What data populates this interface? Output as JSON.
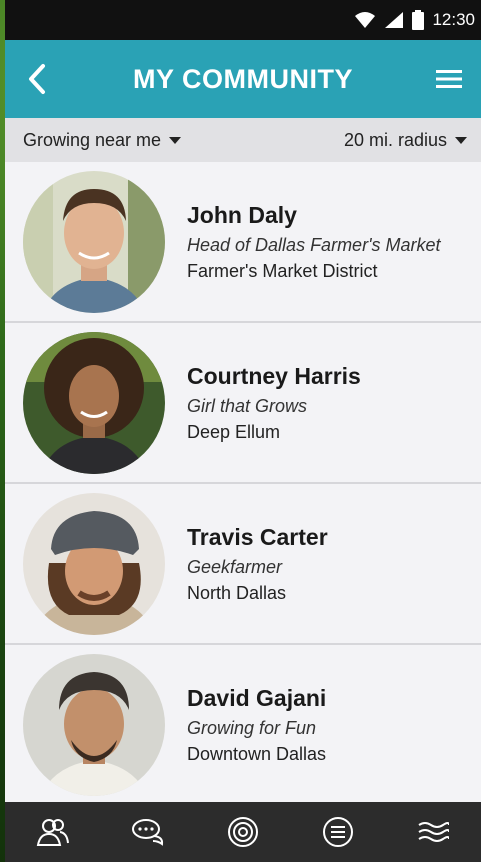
{
  "status": {
    "time": "12:30"
  },
  "header": {
    "title": "MY COMMUNITY"
  },
  "filters": {
    "left": "Growing near me",
    "right": "20 mi. radius"
  },
  "people": [
    {
      "name": "John Daly",
      "role": "Head of Dallas Farmer's Market",
      "location": "Farmer's Market District"
    },
    {
      "name": "Courtney Harris",
      "role": "Girl that Grows",
      "location": "Deep Ellum"
    },
    {
      "name": "Travis Carter",
      "role": "Geekfarmer",
      "location": "North Dallas"
    },
    {
      "name": "David Gajani",
      "role": "Growing for Fun",
      "location": "Downtown Dallas"
    }
  ],
  "colors": {
    "accent": "#2aa2b5",
    "navbar": "#2c2c2c",
    "statusbar": "#111111"
  },
  "icons": {
    "back": "back-chevron-icon",
    "menu": "hamburger-menu-icon",
    "nav": [
      "community-icon",
      "chat-icon",
      "target-icon",
      "list-icon",
      "waves-icon"
    ]
  }
}
